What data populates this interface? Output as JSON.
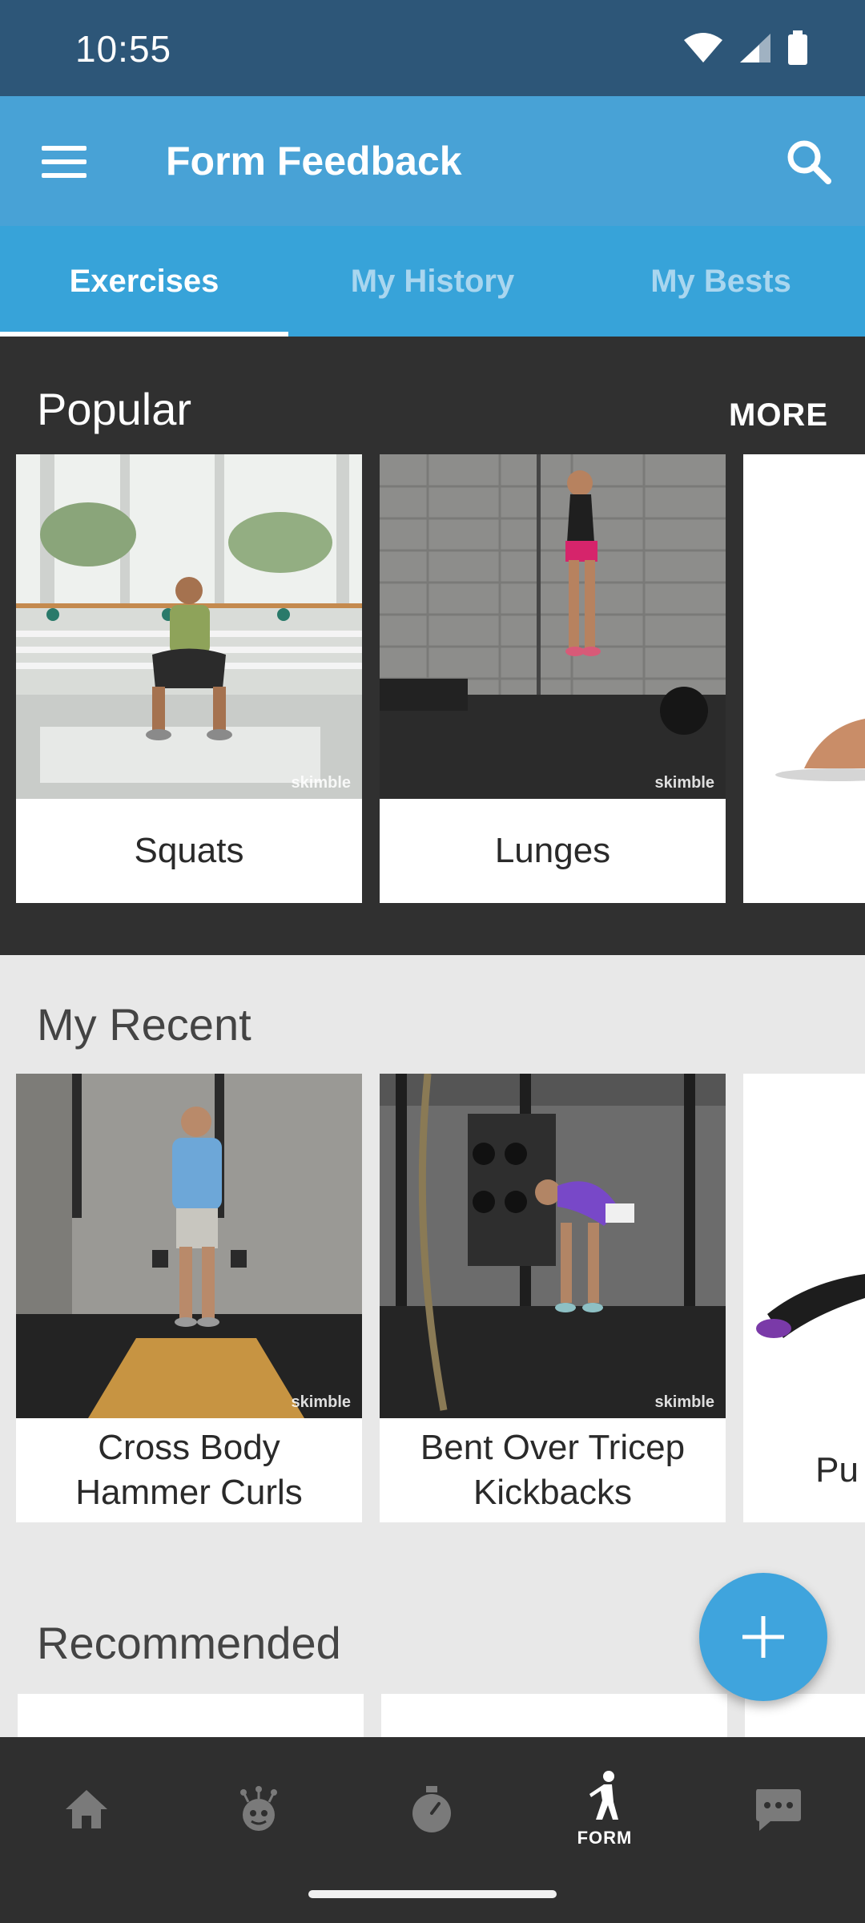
{
  "status_bar": {
    "time": "10:55"
  },
  "app_bar": {
    "title": "Form Feedback"
  },
  "tabs": [
    {
      "label": "Exercises",
      "active": true
    },
    {
      "label": "My History",
      "active": false
    },
    {
      "label": "My Bests",
      "active": false
    }
  ],
  "popular": {
    "title": "Popular",
    "more_label": "MORE",
    "cards": [
      {
        "label": "Squats",
        "watermark": "skimble"
      },
      {
        "label": "Lunges",
        "watermark": "skimble"
      }
    ]
  },
  "recent": {
    "title": "My Recent",
    "cards": [
      {
        "label": "Cross Body Hammer Curls",
        "watermark": "skimble"
      },
      {
        "label": "Bent Over Tricep Kickbacks",
        "watermark": "skimble"
      },
      {
        "label": "Pu"
      }
    ]
  },
  "recommended": {
    "title": "Recommended"
  },
  "bottom_nav": {
    "items": [
      {
        "icon": "home-icon",
        "label": ""
      },
      {
        "icon": "brain-icon",
        "label": ""
      },
      {
        "icon": "stopwatch-icon",
        "label": ""
      },
      {
        "icon": "form-icon",
        "label": "FORM"
      },
      {
        "icon": "chat-icon",
        "label": ""
      }
    ]
  },
  "colors": {
    "status_bar": "#2d5678",
    "app_bar": "#48a2d6",
    "tabs": "#37a3d9",
    "fab": "#3fa4dd",
    "nav": "#2f2f2f"
  }
}
